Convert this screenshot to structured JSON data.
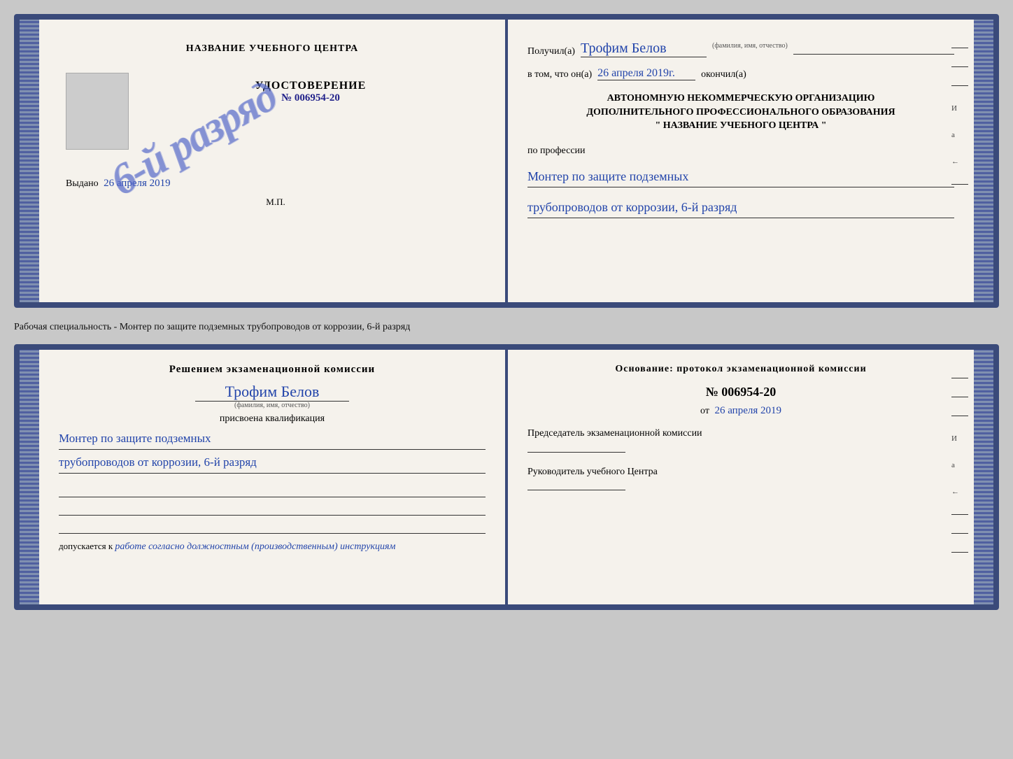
{
  "top_certificate": {
    "left": {
      "school_name": "НАЗВАНИЕ УЧЕБНОГО ЦЕНТРА",
      "udostoverenie_title": "УДОСТОВЕРЕНИЕ",
      "udostoverenie_number": "№ 006954-20",
      "stamp_text": "6-й разряд",
      "vydano_label": "Выдано",
      "vydano_date": "26 апреля 2019",
      "mp_label": "М.П."
    },
    "right": {
      "poluchil_label": "Получил(а)",
      "fio_value": "Трофим Белов",
      "fio_sub": "(фамилия, имя, отчество)",
      "vtom_label": "в том, что он(а)",
      "date_value": "26 апреля 2019г.",
      "okonchil_label": "окончил(а)",
      "org_line1": "АВТОНОМНУЮ НЕКОММЕРЧЕСКУЮ ОРГАНИЗАЦИЮ",
      "org_line2": "ДОПОЛНИТЕЛЬНОГО ПРОФЕССИОНАЛЬНОГО ОБРАЗОВАНИЯ",
      "org_name": "\" НАЗВАНИЕ УЧЕБНОГО ЦЕНТРА \"",
      "po_professii_label": "по профессии",
      "profession_line1": "Монтер по защите подземных",
      "profession_line2": "трубопроводов от коррозии, 6-й разряд"
    }
  },
  "middle_text": "Рабочая специальность - Монтер по защите подземных трубопроводов от коррозии, 6-й разряд",
  "bottom_certificate": {
    "left": {
      "resheniem_title": "Решением экзаменационной комиссии",
      "fio_value": "Трофим Белов",
      "fio_sub": "(фамилия, имя, отчество)",
      "prisvoena_label": "присвоена квалификация",
      "qualification_line1": "Монтер по защите подземных",
      "qualification_line2": "трубопроводов от коррозии, 6-й разряд",
      "dopuskaetsya_label": "допускается к",
      "dopuskaetsya_value": "работе согласно должностным (производственным) инструкциям"
    },
    "right": {
      "osnovanie_title": "Основание: протокол экзаменационной комиссии",
      "protocol_number": "№ 006954-20",
      "ot_label": "от",
      "ot_date": "26 апреля 2019",
      "predsedatel_title": "Председатель экзаменационной комиссии",
      "rukovoditel_title": "Руководитель учебного Центра"
    }
  },
  "edge_marks": {
    "mark_i": "И",
    "mark_a": "а",
    "mark_arrow": "←"
  }
}
